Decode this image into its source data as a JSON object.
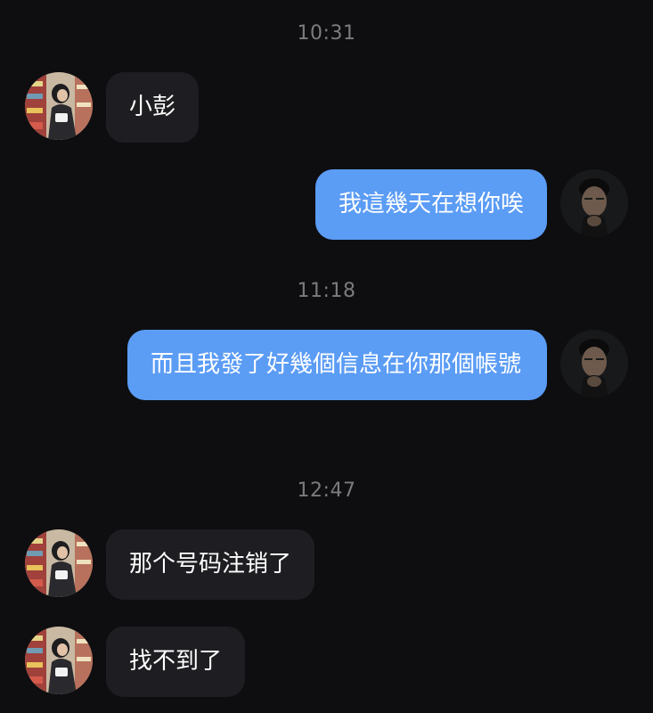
{
  "conversation": {
    "messages": [
      {
        "time": "10:31"
      },
      {
        "sender": "other",
        "text": "小彭"
      },
      {
        "sender": "me",
        "text": "我這幾天在想你唉"
      },
      {
        "time": "11:18"
      },
      {
        "sender": "me",
        "text": "而且我發了好幾個信息在你那個帳號"
      },
      {
        "time": "12:47"
      },
      {
        "sender": "other",
        "text": "那个号码注销了"
      },
      {
        "sender": "other",
        "text": "找不到了"
      }
    ]
  },
  "avatars": {
    "other": "girl-photo-avatar",
    "me": "man-photo-avatar"
  },
  "colors": {
    "background": "#0e0e10",
    "incoming_bubble": "#1e1e22",
    "outgoing_bubble": "#5b9cf5",
    "timestamp_text": "#7b7b80",
    "message_text": "#ffffff"
  }
}
